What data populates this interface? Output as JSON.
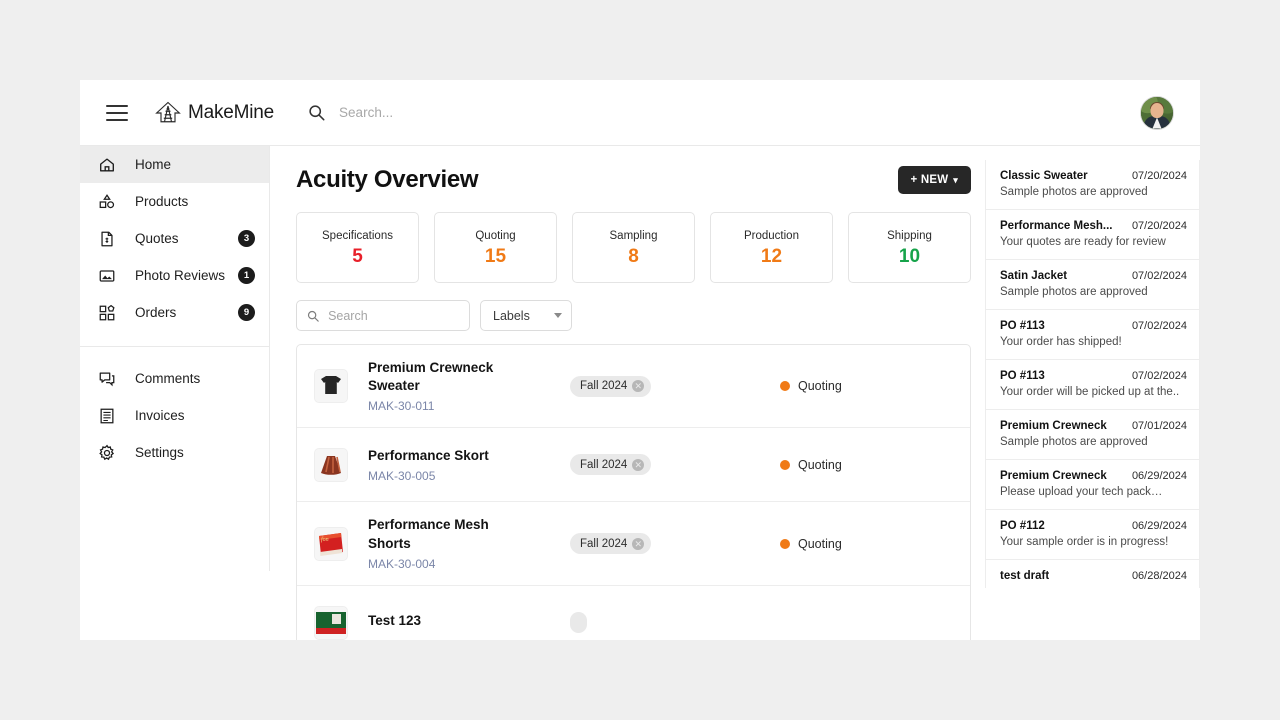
{
  "topbar": {
    "menu_icon": "hamburger-icon",
    "brand_name": "MakeMine",
    "brand_mark": "spool-arrow-logo",
    "search_icon": "search-icon",
    "search_value": "",
    "search_placeholder": "Search...",
    "avatar": "user-avatar"
  },
  "sidebar": {
    "items": [
      {
        "label": "Home",
        "icon": "home-icon",
        "badge": "",
        "active": true
      },
      {
        "label": "Products",
        "icon": "products-icon",
        "badge": "",
        "active": false
      },
      {
        "label": "Quotes",
        "icon": "quote-doc-icon",
        "badge": "3",
        "active": false
      },
      {
        "label": "Photo Reviews",
        "icon": "image-icon",
        "badge": "1",
        "active": false
      },
      {
        "label": "Orders",
        "icon": "orders-grid-icon",
        "badge": "9",
        "active": false
      }
    ],
    "items_secondary": [
      {
        "label": "Comments",
        "icon": "comments-icon",
        "badge": "",
        "active": false
      },
      {
        "label": "Invoices",
        "icon": "invoice-icon",
        "badge": "",
        "active": false
      },
      {
        "label": "Settings",
        "icon": "gear-icon",
        "badge": "",
        "active": false
      }
    ]
  },
  "main": {
    "title": "Acuity Overview",
    "new_button": {
      "label": "+ NEW",
      "chevron": "chevron-down-icon"
    },
    "stats": [
      {
        "label": "Specifications",
        "value": "5",
        "color": "#e8202a"
      },
      {
        "label": "Quoting",
        "value": "15",
        "color": "#f07a16"
      },
      {
        "label": "Sampling",
        "value": "8",
        "color": "#f07a16"
      },
      {
        "label": "Production",
        "value": "12",
        "color": "#f07a16"
      },
      {
        "label": "Shipping",
        "value": "10",
        "color": "#16a34a"
      }
    ],
    "filters": {
      "search_icon": "search-icon",
      "search_value": "",
      "search_placeholder": "Search",
      "labels_label": "Labels",
      "labels_caret": "chevron-down-icon"
    },
    "products": [
      {
        "name": "Premium Crewneck Sweater",
        "sku": "MAK-30-011",
        "chip": "Fall 2024",
        "chip_remove": "remove-chip-icon",
        "status": "Quoting",
        "status_color": "#f07a16",
        "thumb": "black-crewneck-sweater"
      },
      {
        "name": "Performance Skort",
        "sku": "MAK-30-005",
        "chip": "Fall 2024",
        "chip_remove": "remove-chip-icon",
        "status": "Quoting",
        "status_color": "#f07a16",
        "thumb": "rust-pleated-skort"
      },
      {
        "name": "Performance Mesh Shorts",
        "sku": "MAK-30-004",
        "chip": "Fall 2024",
        "chip_remove": "remove-chip-icon",
        "status": "Quoting",
        "status_color": "#f07a16",
        "thumb": "red-mesh-shorts"
      },
      {
        "name": "Test 123",
        "sku": "",
        "chip": "",
        "chip_remove": "remove-chip-icon",
        "status": "",
        "status_color": "#f07a16",
        "thumb": "green-garment"
      }
    ]
  },
  "notifications": [
    {
      "title": "Classic Sweater",
      "date": "07/20/2024",
      "message": "Sample photos are approved"
    },
    {
      "title": "Performance Mesh...",
      "date": "07/20/2024",
      "message": "Your quotes are ready for review"
    },
    {
      "title": "Satin Jacket",
      "date": "07/02/2024",
      "message": "Sample photos are approved"
    },
    {
      "title": "PO #113",
      "date": "07/02/2024",
      "message": "Your order has shipped!"
    },
    {
      "title": "PO #113",
      "date": "07/02/2024",
      "message": "Your order will be picked up at the.."
    },
    {
      "title": "Premium Crewneck",
      "date": "07/01/2024",
      "message": "Sample photos are approved"
    },
    {
      "title": "Premium Crewneck",
      "date": "06/29/2024",
      "message": "Please upload your tech pack…"
    },
    {
      "title": "PO #112",
      "date": "06/29/2024",
      "message": "Your sample order is in progress!"
    },
    {
      "title": "test draft",
      "date": "06/28/2024",
      "message": ""
    }
  ]
}
